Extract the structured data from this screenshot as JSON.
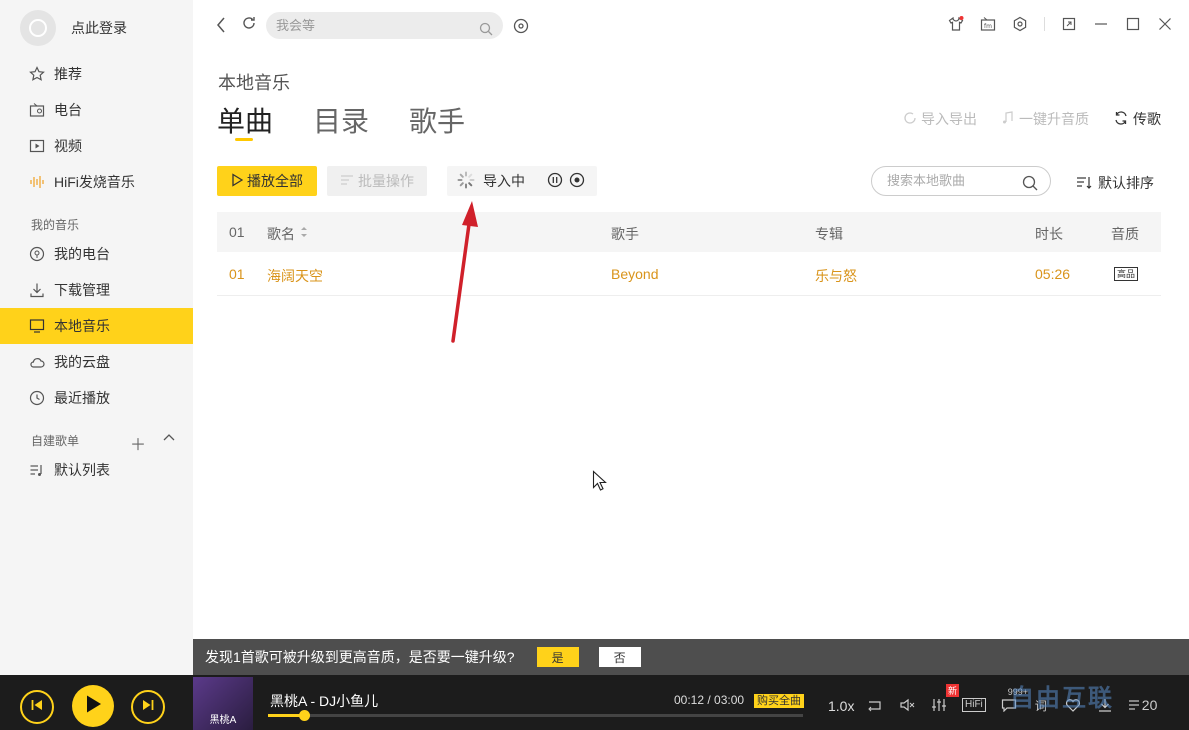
{
  "sidebar": {
    "user_name": "点此登录",
    "nav": [
      {
        "label": "推荐",
        "icon": "star-icon"
      },
      {
        "label": "电台",
        "icon": "radio-icon"
      },
      {
        "label": "视频",
        "icon": "video-icon"
      },
      {
        "label": "HiFi发烧音乐",
        "icon": "waveform-icon"
      }
    ],
    "my_music_title": "我的音乐",
    "my_music": [
      {
        "label": "我的电台",
        "icon": "podcast-icon"
      },
      {
        "label": "下载管理",
        "icon": "download-icon"
      },
      {
        "label": "本地音乐",
        "icon": "monitor-icon",
        "active": true
      },
      {
        "label": "我的云盘",
        "icon": "cloud-icon"
      },
      {
        "label": "最近播放",
        "icon": "clock-icon"
      }
    ],
    "playlist_title": "自建歌单",
    "playlists": [
      {
        "label": "默认列表",
        "icon": "playlist-icon"
      }
    ]
  },
  "topbar": {
    "search_placeholder": "我会等"
  },
  "page": {
    "title": "本地音乐",
    "tabs": [
      "单曲",
      "目录",
      "歌手"
    ],
    "import_export": "导入导出",
    "upgrade_quality": "一键升音质",
    "upload": "传歌",
    "play_all": "播放全部",
    "batch": "批量操作",
    "importing": "导入中",
    "local_search_placeholder": "搜索本地歌曲",
    "sort": "默认排序"
  },
  "table": {
    "headers": {
      "index": "01",
      "name": "歌名",
      "artist": "歌手",
      "album": "专辑",
      "duration": "时长",
      "quality": "音质"
    },
    "rows": [
      {
        "index": "01",
        "name": "海阔天空",
        "artist": "Beyond",
        "album": "乐与怒",
        "duration": "05:26",
        "quality": "高品"
      }
    ]
  },
  "notice": {
    "text": "发现1首歌可被升级到更高音质，是否要一键升级?",
    "yes": "是",
    "no": "否"
  },
  "player": {
    "cover_text": "黑桃A",
    "song": "黑桃A - DJ小鱼儿",
    "time": "00:12 / 03:00",
    "buy": "购买全曲",
    "progress": 0.067,
    "speed": "1.0x",
    "new_badge": "新",
    "hifi": "HiFi",
    "comment_count": "999+",
    "lyric": "词",
    "list_count": "20"
  },
  "watermark": "自由互联",
  "colors": {
    "accent": "#ffd21a",
    "song_highlight": "#d9941b"
  }
}
